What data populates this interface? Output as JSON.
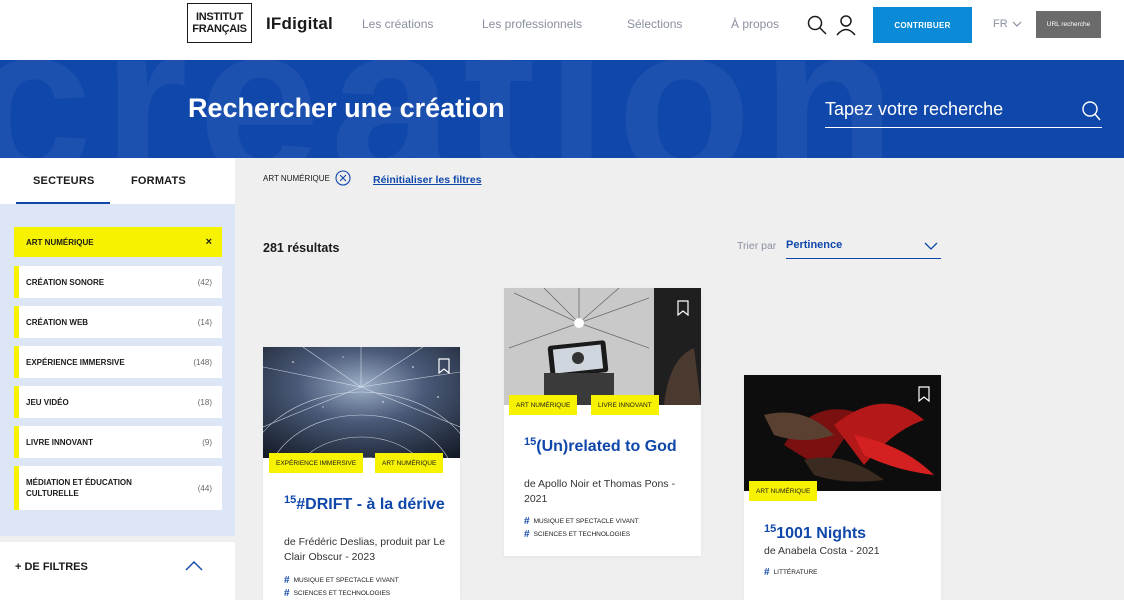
{
  "header": {
    "logo_line1": "INSTITUT",
    "logo_line2": "FRANÇAIS",
    "brand": "IFdigital",
    "nav": [
      "Les créations",
      "Les professionnels",
      "Sélections",
      "À propos"
    ],
    "contribute_label": "CONTRIBUER",
    "lang": "FR",
    "url_button": "URL recherche"
  },
  "hero": {
    "bg_word": "création",
    "title": "Rechercher une création",
    "search_placeholder": "Tapez votre recherche"
  },
  "sidebar": {
    "tabs": [
      "SECTEURS",
      "FORMATS"
    ],
    "filters": [
      {
        "label": "ART NUMÉRIQUE",
        "count": "×",
        "active": true
      },
      {
        "label": "CRÉATION SONORE",
        "count": "(42)"
      },
      {
        "label": "CRÉATION WEB",
        "count": "(14)"
      },
      {
        "label": "EXPÉRIENCE IMMERSIVE",
        "count": "(148)"
      },
      {
        "label": "JEU VIDÉO",
        "count": "(18)"
      },
      {
        "label": "LIVRE INNOVANT",
        "count": "(9)"
      },
      {
        "label": "MÉDIATION ET ÉDUCATION CULTURELLE",
        "count": "(44)"
      }
    ],
    "more_filters": "+ DE FILTRES"
  },
  "toolbar": {
    "active_chip": "ART NUMÉRIQUE",
    "reset_label": "Réinitialiser les filtres",
    "results": "281 résultats",
    "sort_label": "Trier par",
    "sort_value": "Pertinence"
  },
  "cards": [
    {
      "tags": [
        "EXPÉRIENCE IMMERSIVE",
        "ART NUMÉRIQUE"
      ],
      "num": "15",
      "title": "#DRIFT - à la dérive",
      "subtitle": "de Frédéric Deslias, produit par Le Clair Obscur - 2023",
      "cats": [
        "MUSIQUE ET SPECTACLE VIVANT",
        "SCIENCES ET TECHNOLOGIES"
      ]
    },
    {
      "tags": [
        "ART NUMÉRIQUE",
        "LIVRE INNOVANT"
      ],
      "num": "15",
      "title": "(Un)related to God",
      "subtitle": "de Apollo Noir et Thomas Pons - 2021",
      "cats": [
        "MUSIQUE ET SPECTACLE VIVANT",
        "SCIENCES ET TECHNOLOGIES"
      ]
    },
    {
      "tags": [
        "ART NUMÉRIQUE"
      ],
      "num": "15",
      "title": "1001 Nights",
      "subtitle": "de Anabela Costa - 2021",
      "cats": [
        "LITTÉRATURE"
      ]
    }
  ]
}
